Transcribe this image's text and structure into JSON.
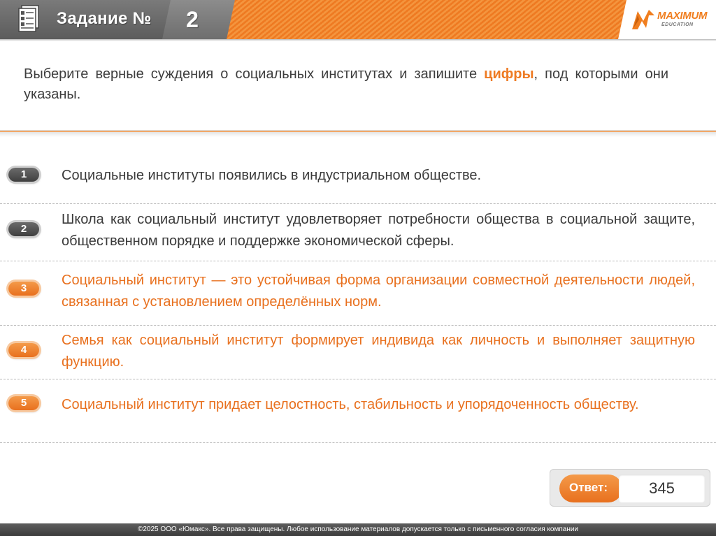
{
  "header": {
    "title": "Задание №",
    "number": "2",
    "logo_text": "MAXIMUM",
    "logo_sub": "EDUCATION",
    "icon": "document-icon"
  },
  "question": {
    "text_before": "Выберите верные суждения о социальных институтах и запишите ",
    "highlight": "цифры",
    "text_after": ", под которыми они указаны."
  },
  "statements": [
    {
      "number": "1",
      "text": "Социальные институты появились в индустриальном обществе.",
      "correct": false
    },
    {
      "number": "2",
      "text": "Школа как социальный институт удовлетворяет потребности общества в социальной защите, общественном порядке и поддержке экономической сферы.",
      "correct": false
    },
    {
      "number": "3",
      "text": "Социальный институт — это устойчивая форма организации совместной деятельности людей, связанная с установлением определённых норм.",
      "correct": true
    },
    {
      "number": "4",
      "text": "Семья как социальный институт формирует индивида как личность и выполняет защитную функцию.",
      "correct": true
    },
    {
      "number": "5",
      "text": "Социальный институт придает целостность, стабильность и упорядоченность обществу.",
      "correct": true
    }
  ],
  "answer": {
    "label": "Ответ:",
    "value": "345"
  },
  "footer": {
    "text": "©2025 ООО «Юмакс». Все права защищены. Любое использование материалов допускается только с письменного согласия компании"
  },
  "colors": {
    "accent": "#ee7a22",
    "dark": "#5c5c5c",
    "text": "#3a3a3a"
  }
}
